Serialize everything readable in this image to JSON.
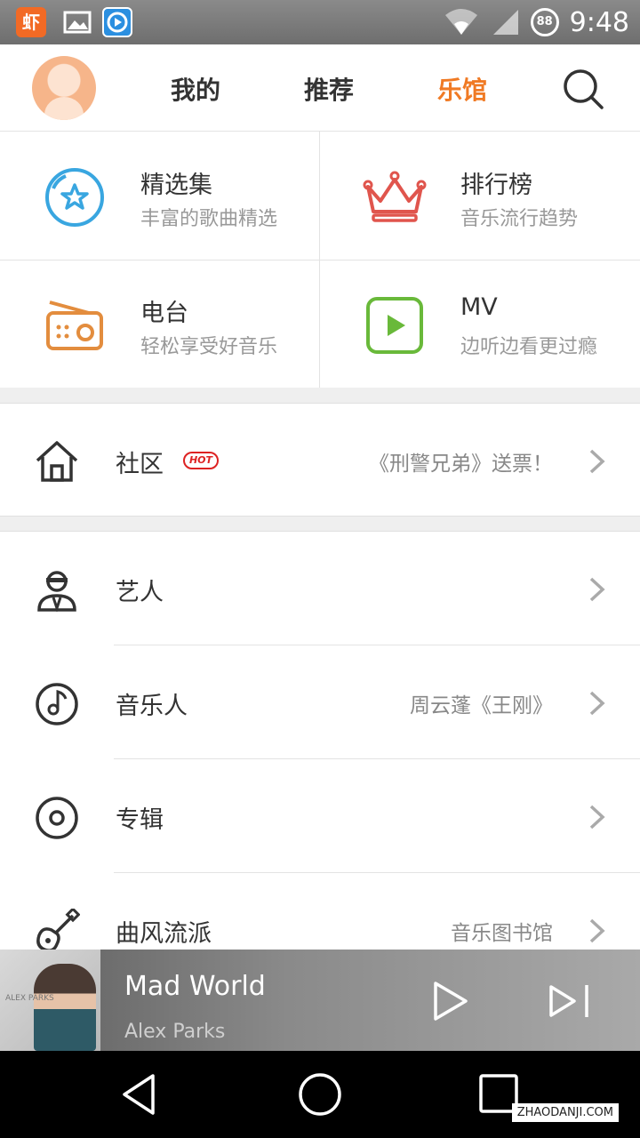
{
  "status_bar": {
    "time": "9:48",
    "badge": "88",
    "app_icon_char": "虾"
  },
  "nav": {
    "tabs": [
      {
        "label": "我的"
      },
      {
        "label": "推荐"
      },
      {
        "label": "乐馆"
      }
    ],
    "active_tab": "乐馆",
    "accent_color": "#f07a24"
  },
  "grid": [
    {
      "title": "精选集",
      "subtitle": "丰富的歌曲精选",
      "icon": "star-circle-icon",
      "color": "#39a6e0"
    },
    {
      "title": "排行榜",
      "subtitle": "音乐流行趋势",
      "icon": "crown-icon",
      "color": "#e0554d"
    },
    {
      "title": "电台",
      "subtitle": "轻松享受好音乐",
      "icon": "radio-icon",
      "color": "#e38d3e"
    },
    {
      "title": "MV",
      "subtitle": "边听边看更过瘾",
      "icon": "play-box-icon",
      "color": "#69b93a"
    }
  ],
  "community": {
    "label": "社区",
    "badge": "HOT",
    "note": "《刑警兄弟》送票！"
  },
  "list": [
    {
      "label": "艺人",
      "note": ""
    },
    {
      "label": "音乐人",
      "note": "周云蓬《王刚》"
    },
    {
      "label": "专辑",
      "note": ""
    },
    {
      "label": "曲风流派",
      "note": "音乐图书馆"
    }
  ],
  "player": {
    "song": "Mad World",
    "artist": "Alex Parks",
    "cover_text": "ALEX PARKS"
  },
  "watermark": "ZHAODANJI.COM"
}
